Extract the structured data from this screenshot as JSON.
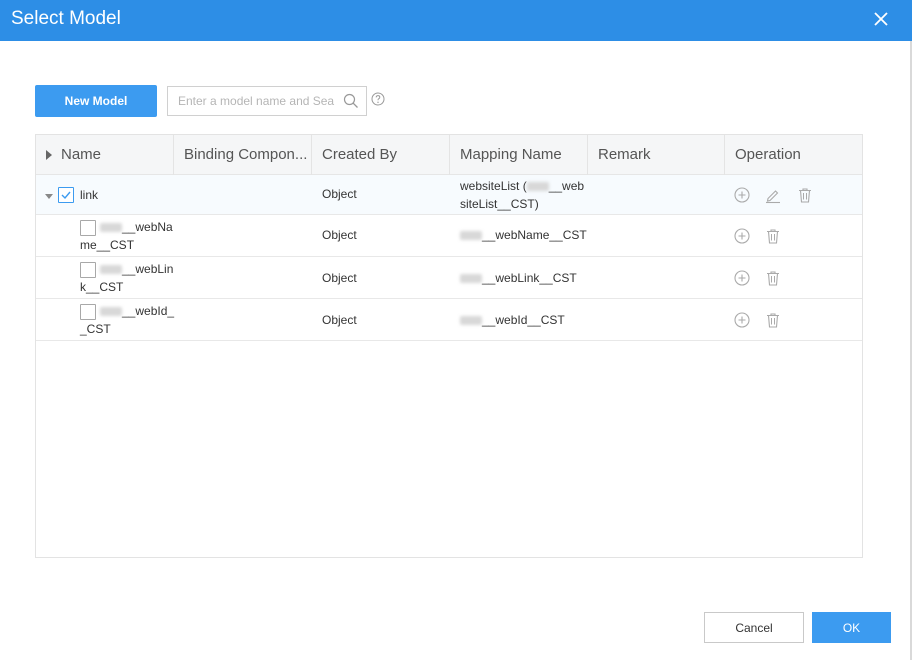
{
  "dialog": {
    "title": "Select Model"
  },
  "toolbar": {
    "new_model_label": "New Model",
    "search_placeholder": "Enter a model name and Sea"
  },
  "table": {
    "columns": [
      "Name",
      "Binding Compon...",
      "Created By",
      "Mapping Name",
      "Remark",
      "Operation"
    ],
    "rows": [
      {
        "name": "link",
        "created_by": "Object",
        "mapping_line1": "websiteList (",
        "mapping_line1_end": "__web",
        "mapping_line2": "siteList__CST)",
        "checked": true
      },
      {
        "name_line1": "__webNa",
        "name_line2": "me__CST",
        "created_by": "Object",
        "mapping": "__webName__CST",
        "checked": false
      },
      {
        "name_line1": "__webLin",
        "name_line2": "k__CST",
        "created_by": "Object",
        "mapping": "__webLink__CST",
        "checked": false
      },
      {
        "name_line1": "__webId_",
        "name_line2": "_CST",
        "created_by": "Object",
        "mapping": "__webId__CST",
        "checked": false
      }
    ]
  },
  "footer": {
    "cancel_label": "Cancel",
    "ok_label": "OK"
  },
  "colors": {
    "header": "#2d8ee6",
    "primary": "#3c9bf0"
  }
}
